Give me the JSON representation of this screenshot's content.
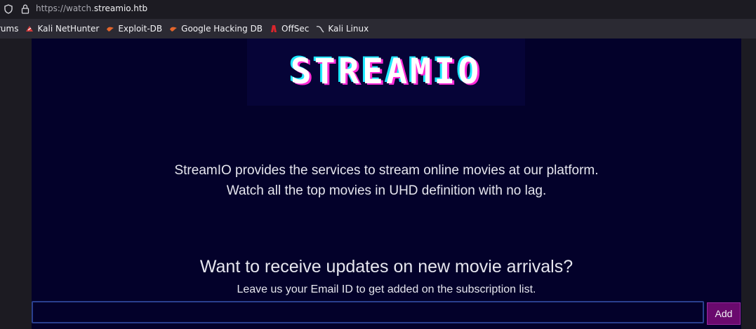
{
  "browser": {
    "url_prefix": "https://watch.",
    "url_host": "streamio.htb",
    "bookmarks": [
      {
        "label": "rums",
        "icon": "forum-icon",
        "color": "#7a7a85"
      },
      {
        "label": "Kali NetHunter",
        "icon": "nethunter-icon",
        "color": "#d33a3a"
      },
      {
        "label": "Exploit-DB",
        "icon": "exploitdb-icon",
        "color": "#e3652b"
      },
      {
        "label": "Google Hacking DB",
        "icon": "ghdb-icon",
        "color": "#e3652b"
      },
      {
        "label": "OffSec",
        "icon": "offsec-icon",
        "color": "#d9252c"
      },
      {
        "label": "Kali Linux",
        "icon": "kali-dragon-icon",
        "color": "#cfcfd6"
      }
    ]
  },
  "page": {
    "logo_text": "STREAMIO",
    "tagline_line1": "StreamIO provides the services to stream online movies at our platform.",
    "tagline_line2": "Watch all the top movies in UHD definition with no lag.",
    "subscribe_title": "Want to receive updates on new movie arrivals?",
    "subscribe_subtitle": "Leave us your Email ID to get added on the subscription list.",
    "email_value": "",
    "add_label": "Add"
  }
}
